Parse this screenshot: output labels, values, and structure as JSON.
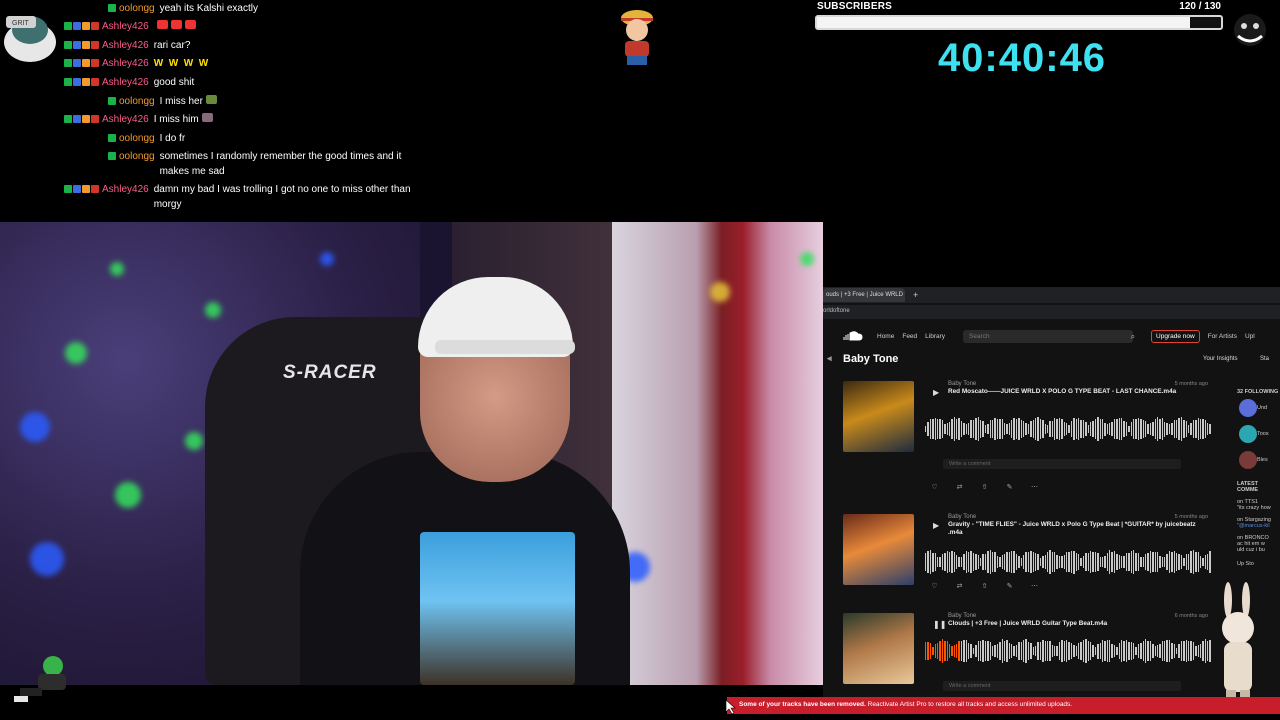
{
  "chat": {
    "messages": [
      {
        "user": "oolongg",
        "text": "yeah its Kalshi exactly"
      },
      {
        "user": "Ashley426",
        "text": ""
      },
      {
        "user": "Ashley426",
        "text": "rari car?"
      },
      {
        "user": "Ashley426",
        "text": "W  W  W  W"
      },
      {
        "user": "Ashley426",
        "text": "good shit"
      },
      {
        "user": "oolongg",
        "text": "I miss her"
      },
      {
        "user": "Ashley426",
        "text": "I miss him"
      },
      {
        "user": "oolongg",
        "text": "I do fr"
      },
      {
        "user": "oolongg",
        "text": "sometimes I randomly remember the good times and it makes me sad"
      },
      {
        "user": "Ashley426",
        "text": "damn my bad I was trolling I got no one to miss other than morgy"
      }
    ]
  },
  "subscribers": {
    "label": "SUBSCRIBERS",
    "count": "120 / 130",
    "progress": 0.923
  },
  "timer": "40:40:46",
  "webcam": {
    "chair_brand": "S-RACER"
  },
  "browser": {
    "tab_title": "ouds | +3 Free | Juice WRLD",
    "url": "orldoftone",
    "nav": {
      "home": "Home",
      "feed": "Feed",
      "library": "Library",
      "search_placeholder": "Search",
      "upgrade": "Upgrade now",
      "for_artists": "For Artists",
      "upload": "Upl"
    },
    "profile_name": "Baby Tone",
    "insights": "Your Insights",
    "insights2": "Sta",
    "tracks": [
      {
        "artist": "Baby Tone",
        "title": "Red Moscato——JUICE WRLD X POLO G TYPE BEAT - LAST CHANCE.m4a",
        "date": "5 months ago",
        "comment": "Write a comment",
        "progress": 0.0
      },
      {
        "artist": "Baby Tone",
        "title": "Gravity - \"TIME FLIES\" - Juice WRLD x Polo G Type Beat | *GUITAR* by juicebeatz .m4a",
        "date": "5 months ago",
        "comment": "",
        "progress": 0.0
      },
      {
        "artist": "Baby Tone",
        "title": "Clouds | +3 Free | Juice WRLD Guitar Type Beat.m4a",
        "date": "6 months ago",
        "comment": "Write a comment",
        "progress": 0.12
      }
    ],
    "sidebar": {
      "following": "32 FOLLOWING",
      "latest": "LATEST COMME",
      "lines": [
        "Und",
        "Toos",
        "Bles",
        "on TTS1",
        "\"its crazy how",
        "on Stargazing",
        "\"@marcus-kil",
        "on BRONCO",
        "ac hit em w",
        "uld cuz i bu",
        "Up Sto"
      ]
    }
  },
  "toast": {
    "bold": "Some of your tracks have been removed.",
    "rest": " Reactivate Artist Pro to restore all tracks and access unlimited uploads."
  }
}
